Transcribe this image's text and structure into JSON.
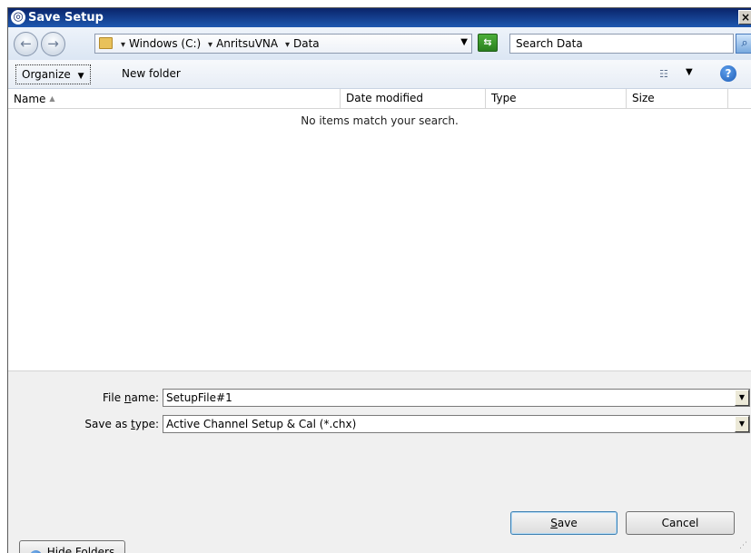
{
  "window": {
    "title": "Save Setup",
    "close_label": "×"
  },
  "nav": {
    "back_icon": "back-arrow-icon",
    "forward_icon": "forward-arrow-icon",
    "breadcrumbs": [
      "Windows (C:)",
      "AnritsuVNA",
      "Data"
    ],
    "search_placeholder": "Search Data"
  },
  "toolbar": {
    "organize_label": "Organize",
    "new_folder_label": "New folder"
  },
  "list": {
    "columns": [
      "Name",
      "Date modified",
      "Type",
      "Size"
    ],
    "empty_message": "No items match your search."
  },
  "form": {
    "file_name_label_pre": "File ",
    "file_name_label_accel": "n",
    "file_name_label_post": "ame:",
    "file_name_value": "SetupFile#1",
    "save_type_label_pre": "Save as ",
    "save_type_label_accel": "t",
    "save_type_label_post": "ype:",
    "save_type_value": "Active Channel Setup & Cal (*.chx)"
  },
  "footer": {
    "hide_folders_label": "Hide Folders",
    "save_accel": "S",
    "save_rest": "ave",
    "cancel_label": "Cancel"
  }
}
